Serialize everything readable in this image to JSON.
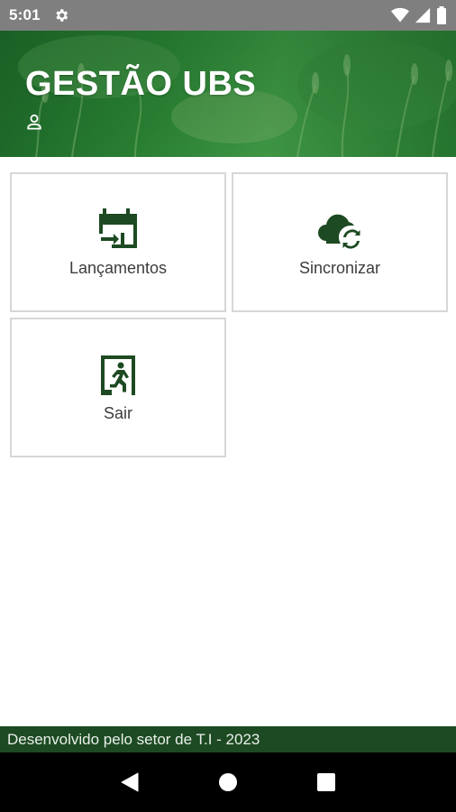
{
  "status_bar": {
    "time": "5:01",
    "icons": [
      "settings-icon",
      "wifi-icon",
      "signal-icon",
      "battery-icon"
    ]
  },
  "header": {
    "title": "GESTÃO UBS",
    "user_icon": "user-icon"
  },
  "menu": {
    "items": [
      {
        "label": "Lançamentos",
        "icon": "calendar-entry-icon"
      },
      {
        "label": "Sincronizar",
        "icon": "cloud-sync-icon"
      },
      {
        "label": "Sair",
        "icon": "exit-door-icon"
      }
    ]
  },
  "footer": {
    "text": "Desenvolvido pelo setor de T.I - 2023"
  },
  "navigation": {
    "buttons": [
      "back-icon",
      "home-icon",
      "recents-icon"
    ]
  },
  "colors": {
    "status_bar": "#7f7f7f",
    "header_green": "#2f8a38",
    "icon_dark_green": "#1d4a22",
    "footer": "#1d4a22",
    "tile_border": "#d7d7d7"
  }
}
